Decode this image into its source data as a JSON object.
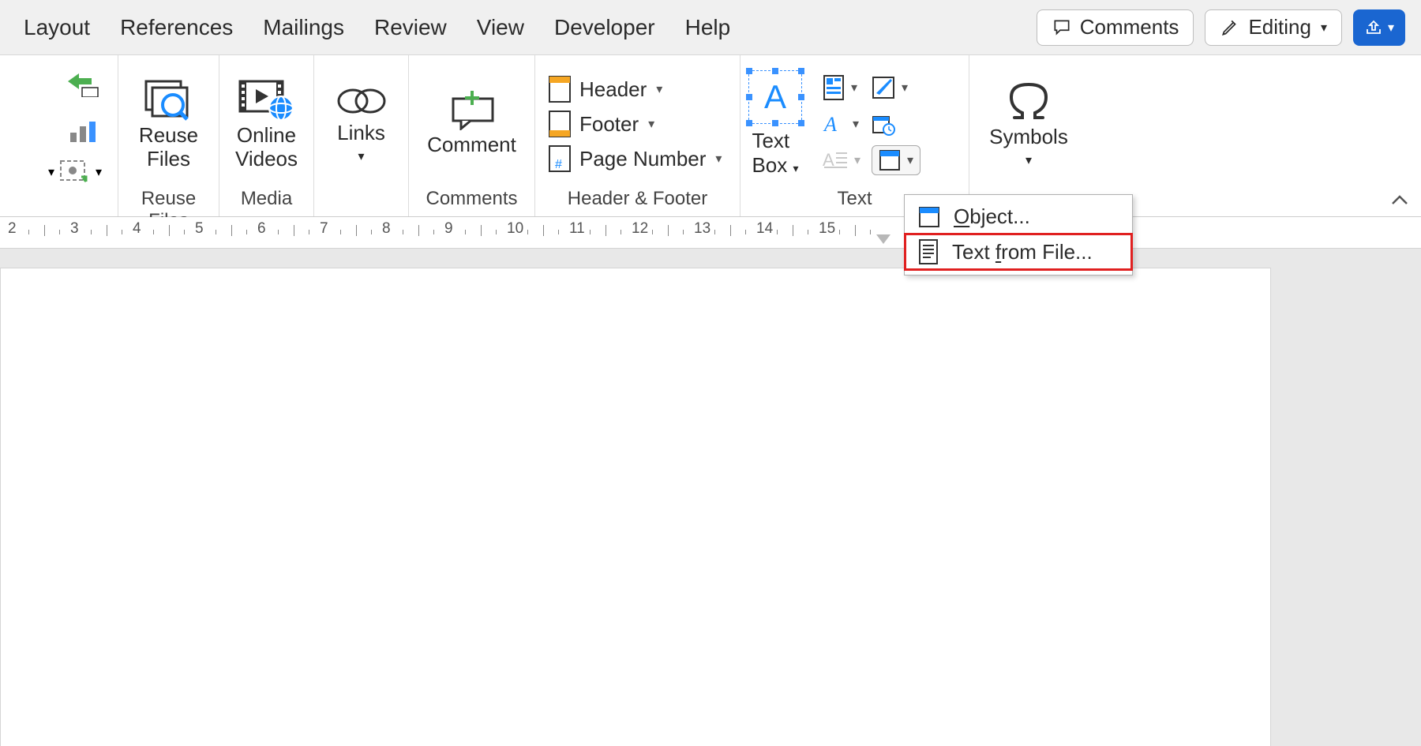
{
  "tabs": {
    "items": [
      "Layout",
      "References",
      "Mailings",
      "Review",
      "View",
      "Developer",
      "Help"
    ]
  },
  "topright": {
    "comments": "Comments",
    "editing": "Editing"
  },
  "ribbon": {
    "small_group": {
      "label": ""
    },
    "reuse_files": {
      "title": "Reuse\nFiles",
      "group": "Reuse Files"
    },
    "media": {
      "title": "Online\nVideos",
      "group": "Media"
    },
    "links": {
      "title": "Links",
      "group": ""
    },
    "comments_grp": {
      "title": "Comment",
      "group": "Comments"
    },
    "header_footer": {
      "header": "Header",
      "footer": "Footer",
      "page_number": "Page Number",
      "group": "Header & Footer"
    },
    "text_group": {
      "textbox": "Text\nBox",
      "group": "Text"
    },
    "symbols": {
      "title": "Symbols",
      "group": ""
    }
  },
  "dropdown": {
    "object": "bject...",
    "object_prefix": "O",
    "text_from_file_prefix": "Text ",
    "text_from_file_u": "f",
    "text_from_file_rest": "rom File..."
  },
  "ruler": {
    "labels": [
      "2",
      "3",
      "4",
      "5",
      "6",
      "7",
      "8",
      "9",
      "10",
      "11",
      "12",
      "13",
      "14",
      "15"
    ]
  }
}
